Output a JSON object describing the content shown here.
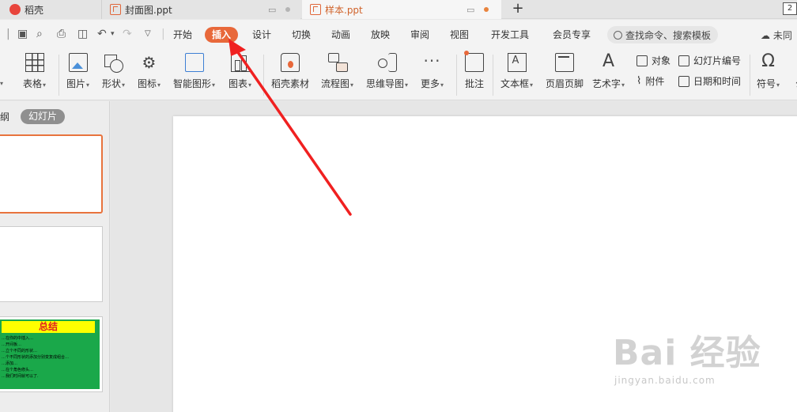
{
  "tabs": [
    {
      "label": "稻壳"
    },
    {
      "label": "封面图.ppt"
    },
    {
      "label": "样本.ppt"
    }
  ],
  "tab_add": "+",
  "window_count": "2",
  "menu": {
    "items": [
      "开始",
      "插入",
      "设计",
      "切换",
      "动画",
      "放映",
      "审阅",
      "视图",
      "开发工具",
      "会员专享"
    ],
    "active": "插入",
    "search_label": "查找命令、搜索模板",
    "cloud_label": "未同"
  },
  "ribbon": {
    "table": "表格",
    "picture": "图片",
    "shape": "形状",
    "icon": "图标",
    "smartart": "智能图形",
    "chart": "图表",
    "material": "稻壳素材",
    "flowchart": "流程图",
    "mindmap": "思维导图",
    "more": "更多",
    "comment": "批注",
    "textbox": "文本框",
    "header_footer": "页眉页脚",
    "wordart": "艺术字",
    "object": "对象",
    "slide_number": "幻灯片编号",
    "attachment": "附件",
    "datetime": "日期和时间",
    "symbol": "符号",
    "formula": "公"
  },
  "left_panel": {
    "outline_tab": "纲",
    "slides_tab": "幻灯片",
    "thumb3_title": "总结",
    "thumb3_lines": [
      "…在你的中插入…",
      "…开间板…",
      "…立个不同的形状…",
      "…个不同形状的添加分别变复成组合…",
      "…添加…",
      "…在个角色修头…",
      "…我们时间就可以了."
    ]
  },
  "watermark": {
    "main": "Bai 经验",
    "sub": "jingyan.baidu.com"
  },
  "accent_color": "#e8683a",
  "arrow_color": "#f02020"
}
